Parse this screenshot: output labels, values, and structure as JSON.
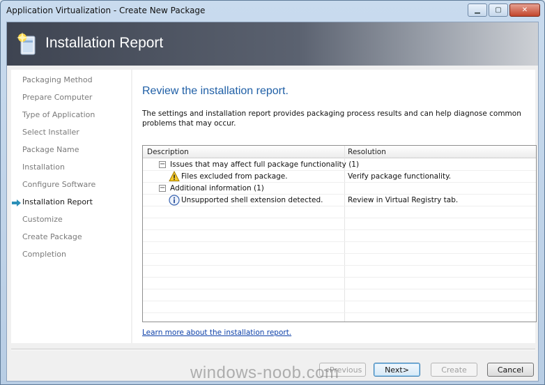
{
  "window": {
    "title": "Application Virtualization - Create New Package",
    "minimize_glyph": "▁",
    "maximize_glyph": "▢",
    "close_glyph": "✕"
  },
  "banner": {
    "title": "Installation Report",
    "icon": "package-wizard-icon"
  },
  "nav": {
    "items": [
      {
        "label": "Packaging Method",
        "active": false
      },
      {
        "label": "Prepare Computer",
        "active": false
      },
      {
        "label": "Type of Application",
        "active": false
      },
      {
        "label": "Select Installer",
        "active": false
      },
      {
        "label": "Package Name",
        "active": false
      },
      {
        "label": "Installation",
        "active": false
      },
      {
        "label": "Configure Software",
        "active": false
      },
      {
        "label": "Installation Report",
        "active": true
      },
      {
        "label": "Customize",
        "active": false
      },
      {
        "label": "Create Package",
        "active": false
      },
      {
        "label": "Completion",
        "active": false
      }
    ]
  },
  "content": {
    "heading": "Review the installation report.",
    "description": "The settings and installation report provides packaging process results and can help diagnose common problems that may occur.",
    "columns": {
      "description": "Description",
      "resolution": "Resolution"
    },
    "rows": [
      {
        "type": "group",
        "toggle": "−",
        "description": "Issues that may affect full package functionality (1)",
        "resolution": ""
      },
      {
        "type": "item",
        "icon": "warning-icon",
        "description": "Files excluded from package.",
        "resolution": "Verify package functionality."
      },
      {
        "type": "group",
        "toggle": "−",
        "description": "Additional information (1)",
        "resolution": ""
      },
      {
        "type": "item",
        "icon": "info-icon",
        "description": "Unsupported shell extension detected.",
        "resolution": "Review in Virtual Registry tab."
      }
    ],
    "learn_more": "Learn more about the installation report."
  },
  "buttons": {
    "previous": "<Previous",
    "next": "Next>",
    "create": "Create",
    "cancel": "Cancel"
  },
  "watermark": "windows-noob.com",
  "colors": {
    "heading": "#1f5fa6",
    "link": "#0b3fa8",
    "banner_dark": "#3e4451",
    "nav_arrow": "#2a8fb8"
  }
}
